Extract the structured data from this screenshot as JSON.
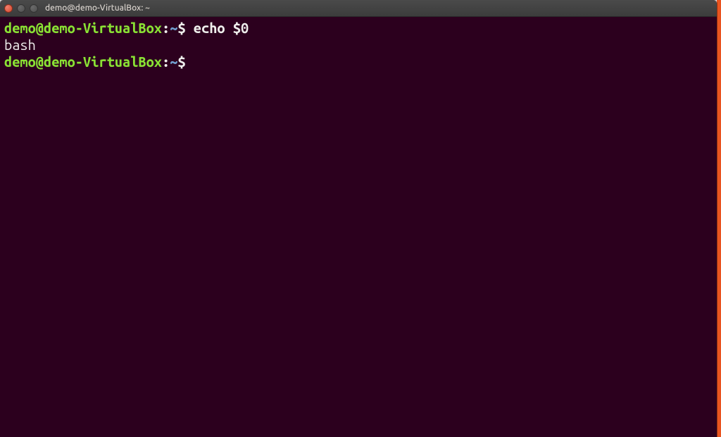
{
  "window": {
    "title": "demo@demo-VirtualBox: ~"
  },
  "terminal": {
    "lines": [
      {
        "type": "prompt_cmd",
        "user_host": "demo@demo-VirtualBox",
        "colon": ":",
        "path": "~",
        "dollar": "$",
        "command": " echo $0"
      },
      {
        "type": "output",
        "text": "bash"
      },
      {
        "type": "prompt_cmd",
        "user_host": "demo@demo-VirtualBox",
        "colon": ":",
        "path": "~",
        "dollar": "$",
        "command": ""
      }
    ]
  }
}
